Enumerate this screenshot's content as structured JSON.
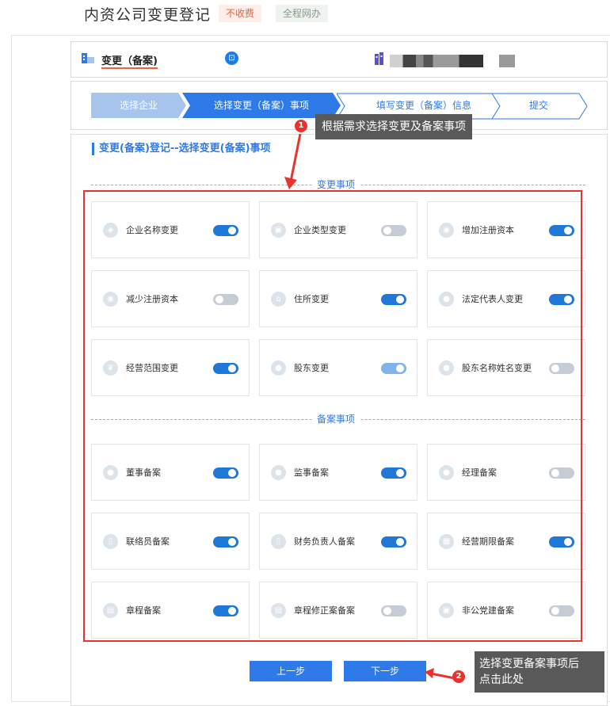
{
  "header": {
    "title": "内资公司变更登记",
    "tag_fee": "不收费",
    "tag_online": "全程网办"
  },
  "bar": {
    "biz_label": "变更（备案)",
    "qr_glyph": "⊡"
  },
  "steps": [
    {
      "label": "选择企业"
    },
    {
      "label": "选择变更（备案）事项"
    },
    {
      "label": "填写变更（备案）信息"
    },
    {
      "label": "提交"
    }
  ],
  "section_title": "变更(备案)登记--选择变更(备案)事项",
  "change_divider": "变更事项",
  "filing_divider": "备案事项",
  "change_items": [
    {
      "label": "企业名称变更",
      "icon": "tag-icon",
      "glyph": "◈",
      "state": "on"
    },
    {
      "label": "企业类型变更",
      "icon": "doc-icon",
      "glyph": "▣",
      "state": "off"
    },
    {
      "label": "增加注册资本",
      "icon": "money-bag-icon",
      "glyph": "◉",
      "state": "on"
    },
    {
      "label": "减少注册资本",
      "icon": "money-bag-icon",
      "glyph": "◉",
      "state": "off"
    },
    {
      "label": "住所变更",
      "icon": "house-icon",
      "glyph": "⌂",
      "state": "on"
    },
    {
      "label": "法定代表人变更",
      "icon": "person-icon",
      "glyph": "●",
      "state": "on"
    },
    {
      "label": "经营范围变更",
      "icon": "crown-icon",
      "glyph": "♛",
      "state": "on"
    },
    {
      "label": "股东变更",
      "icon": "group-icon",
      "glyph": "●",
      "state": "half"
    },
    {
      "label": "股东名称姓名变更",
      "icon": "person-icon",
      "glyph": "●",
      "state": "off"
    }
  ],
  "filing_items": [
    {
      "label": "董事备案",
      "icon": "person-icon",
      "glyph": "●",
      "state": "on"
    },
    {
      "label": "监事备案",
      "icon": "person-icon",
      "glyph": "●",
      "state": "on"
    },
    {
      "label": "经理备案",
      "icon": "person-icon",
      "glyph": "●",
      "state": "off"
    },
    {
      "label": "联络员备案",
      "icon": "id-card-icon",
      "glyph": "▯",
      "state": "on"
    },
    {
      "label": "财务负责人备案",
      "icon": "id-card-icon",
      "glyph": "▯",
      "state": "on"
    },
    {
      "label": "经营期限备案",
      "icon": "calendar-icon",
      "glyph": "▦",
      "state": "on"
    },
    {
      "label": "章程备案",
      "icon": "doc-icon",
      "glyph": "▤",
      "state": "on"
    },
    {
      "label": "章程修正案备案",
      "icon": "doc-edit-icon",
      "glyph": "▤",
      "state": "off"
    },
    {
      "label": "非公党建备案",
      "icon": "flag-icon",
      "glyph": "▣",
      "state": "off"
    }
  ],
  "buttons": {
    "prev": "上一步",
    "next": "下一步"
  },
  "annotations": [
    {
      "number": "1",
      "text": "根据需求选择变更及备案事项"
    },
    {
      "number": "2",
      "text_line1": "选择变更备案事项后",
      "text_line2": "点击此处"
    }
  ],
  "colors": {
    "primary": "#2e7ae8",
    "annotation_red": "#e8322e",
    "tip_bg": "#595959",
    "fee_tag": "#e8643c"
  }
}
